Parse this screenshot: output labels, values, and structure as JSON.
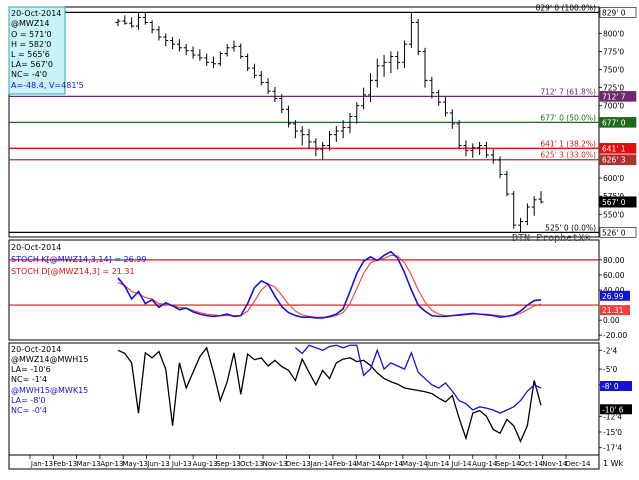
{
  "chart_data": [
    {
      "type": "bar",
      "style": "ohlc",
      "panel": "price",
      "info": {
        "date": "20-Oct-2014",
        "symbol": "@MWZ14",
        "lines": [
          "O = 571'0",
          "H = 582'0",
          "L = 565'6",
          "LA= 567'0",
          "NC= -4'0",
          "A=-48.4, V=481'5"
        ]
      },
      "watermark": "DTN ProphetX®",
      "ylim": [
        520,
        835
      ],
      "y_ticks": [
        {
          "value": 800,
          "label": "800'0"
        },
        {
          "value": 775,
          "label": "775'0"
        },
        {
          "value": 750,
          "label": "750'0"
        },
        {
          "value": 725,
          "label": "725'0"
        },
        {
          "value": 700,
          "label": "700'0"
        },
        {
          "value": 600,
          "label": "600'0"
        },
        {
          "value": 575,
          "label": "575'0"
        },
        {
          "value": 550,
          "label": "550'0"
        }
      ],
      "retracements": [
        {
          "value": 829,
          "label": "829' 0 (100.0%)",
          "color": "#000000",
          "tag": "829' 0",
          "tag_bg": "#ffffff",
          "tag_fg": "#000000"
        },
        {
          "value": 712.875,
          "label": "712' 7 (61.8%)",
          "color": "#6e2a6e",
          "tag": "712' 7",
          "tag_bg": "#6e2a6e",
          "tag_fg": "#ffffff"
        },
        {
          "value": 677,
          "label": "677' 0 (50.0%)",
          "color": "#1e6b1e",
          "tag": "677' 0",
          "tag_bg": "#1e6b1e",
          "tag_fg": "#ffffff"
        },
        {
          "value": 641.125,
          "label": "641' 1 (38.2%)",
          "color": "#e01010",
          "tag": "641' 1",
          "tag_bg": "#e01010",
          "tag_fg": "#ffffff"
        },
        {
          "value": 625.375,
          "label": "625' 3 (33.0%)",
          "color": "#b03030",
          "tag": "626' 3",
          "tag_bg": "#b03030",
          "tag_fg": "#ffffff"
        },
        {
          "value": 525,
          "label": "525' 0 (0.0%)",
          "color": "#000000",
          "tag": "526' 0",
          "tag_bg": "#ffffff",
          "tag_fg": "#000000"
        }
      ],
      "last_tag": {
        "value": 567,
        "label": "567' 0"
      },
      "weekly_ohlc": [
        [
          815,
          820,
          810,
          817
        ],
        [
          817,
          825,
          812,
          814
        ],
        [
          814,
          822,
          808,
          810
        ],
        [
          810,
          828,
          805,
          822
        ],
        [
          822,
          829,
          812,
          815
        ],
        [
          815,
          818,
          800,
          805
        ],
        [
          805,
          810,
          790,
          795
        ],
        [
          795,
          800,
          782,
          790
        ],
        [
          790,
          795,
          778,
          785
        ],
        [
          785,
          792,
          775,
          780
        ],
        [
          780,
          785,
          770,
          776
        ],
        [
          776,
          782,
          765,
          770
        ],
        [
          770,
          778,
          762,
          766
        ],
        [
          766,
          772,
          755,
          760
        ],
        [
          760,
          768,
          752,
          758
        ],
        [
          758,
          775,
          755,
          772
        ],
        [
          772,
          785,
          768,
          780
        ],
        [
          780,
          790,
          775,
          782
        ],
        [
          782,
          786,
          765,
          768
        ],
        [
          768,
          772,
          748,
          752
        ],
        [
          752,
          758,
          738,
          742
        ],
        [
          742,
          748,
          728,
          732
        ],
        [
          732,
          738,
          716,
          720
        ],
        [
          720,
          726,
          705,
          710
        ],
        [
          710,
          716,
          690,
          695
        ],
        [
          695,
          700,
          670,
          675
        ],
        [
          675,
          680,
          655,
          665
        ],
        [
          665,
          672,
          645,
          660
        ],
        [
          660,
          668,
          640,
          650
        ],
        [
          650,
          655,
          630,
          640
        ],
        [
          640,
          650,
          625,
          645
        ],
        [
          645,
          665,
          638,
          660
        ],
        [
          660,
          672,
          650,
          665
        ],
        [
          665,
          680,
          655,
          670
        ],
        [
          670,
          690,
          662,
          685
        ],
        [
          685,
          705,
          675,
          700
        ],
        [
          700,
          725,
          695,
          715
        ],
        [
          715,
          745,
          705,
          735
        ],
        [
          735,
          765,
          725,
          755
        ],
        [
          755,
          770,
          740,
          760
        ],
        [
          760,
          775,
          745,
          768
        ],
        [
          768,
          775,
          750,
          760
        ],
        [
          760,
          790,
          752,
          785
        ],
        [
          785,
          828,
          780,
          815
        ],
        [
          815,
          820,
          770,
          775
        ],
        [
          775,
          780,
          725,
          735
        ],
        [
          735,
          740,
          710,
          718
        ],
        [
          718,
          722,
          700,
          705
        ],
        [
          705,
          712,
          685,
          690
        ],
        [
          690,
          695,
          668,
          675
        ],
        [
          675,
          680,
          640,
          645
        ],
        [
          645,
          652,
          630,
          638
        ],
        [
          638,
          648,
          628,
          642
        ],
        [
          642,
          650,
          632,
          645
        ],
        [
          645,
          650,
          628,
          632
        ],
        [
          632,
          640,
          620,
          625
        ],
        [
          625,
          630,
          600,
          605
        ],
        [
          605,
          610,
          575,
          578
        ],
        [
          578,
          582,
          530,
          535
        ],
        [
          535,
          545,
          525,
          540
        ],
        [
          540,
          565,
          535,
          560
        ],
        [
          560,
          575,
          548,
          570
        ],
        [
          571,
          582,
          565,
          567
        ]
      ],
      "x_labels": [
        "Jan-13",
        "Feb-13",
        "Mar-13",
        "Apr-13",
        "May-13",
        "Jun-13",
        "Jul-13",
        "Aug-13",
        "Sep-13",
        "Oct-13",
        "Nov-13",
        "Dec-13",
        "Jan-14",
        "Feb-14",
        "Mar-14",
        "Apr-14",
        "May-14",
        "Jun-14",
        "Jul-14",
        "Aug-14",
        "Sep-14",
        "Oct-14",
        "Nov-14",
        "Dec-14"
      ],
      "period_label": "1 Wk"
    },
    {
      "type": "line",
      "panel": "stochastic",
      "date": "20-Oct-2014",
      "ylim": [
        -25,
        105
      ],
      "y_ticks": [
        {
          "value": 80,
          "label": "80.00"
        },
        {
          "value": 60,
          "label": "60.00"
        },
        {
          "value": 40,
          "label": "40.00"
        },
        {
          "value": 0,
          "label": "0.00"
        },
        {
          "value": -20,
          "label": "-20.00"
        }
      ],
      "levels": [
        {
          "value": 80,
          "color": "#e01010"
        },
        {
          "value": 20,
          "color": "#e01010"
        }
      ],
      "series": [
        {
          "name": "STOCH K[@MWZ14,3,14] = 26.99",
          "color": "#1414d8",
          "tag": "26.99",
          "values": [
            56,
            45,
            28,
            38,
            22,
            27,
            17,
            23,
            19,
            14,
            16,
            11,
            8,
            6,
            5,
            6,
            8,
            5,
            6,
            22,
            43,
            52,
            48,
            32,
            18,
            10,
            6,
            4,
            4,
            3,
            3,
            5,
            8,
            15,
            38,
            62,
            78,
            84,
            79,
            86,
            91,
            82,
            63,
            40,
            20,
            12,
            6,
            5,
            5,
            6,
            7,
            8,
            9,
            8,
            7,
            6,
            4,
            5,
            7,
            12,
            20,
            26,
            27
          ]
        },
        {
          "name": "STOCH D[@MWZ14,3] = 21.31",
          "color": "#ff3a3a",
          "tag": "21.31",
          "values": [
            50,
            46,
            38,
            35,
            30,
            28,
            22,
            21,
            19,
            17,
            16,
            13,
            10,
            8,
            7,
            6,
            6,
            6,
            6,
            12,
            25,
            40,
            48,
            44,
            33,
            21,
            12,
            7,
            5,
            4,
            4,
            4,
            6,
            10,
            22,
            42,
            62,
            76,
            80,
            82,
            86,
            85,
            76,
            60,
            40,
            24,
            13,
            8,
            6,
            6,
            6,
            7,
            8,
            8,
            8,
            7,
            6,
            5,
            6,
            9,
            14,
            19,
            21.31
          ]
        }
      ]
    },
    {
      "type": "line",
      "panel": "spread",
      "date": "20-Oct-2014",
      "ylim": [
        -18.5,
        -1
      ],
      "y_ticks": [
        {
          "value": -2,
          "label": "-2'4"
        },
        {
          "value": -5,
          "label": "-5'0"
        },
        {
          "value": -7.5,
          "label": "-7'4"
        },
        {
          "value": -12.5,
          "label": "-12'4"
        },
        {
          "value": -15,
          "label": "-15'0"
        },
        {
          "value": -17.5,
          "label": "-17'4"
        }
      ],
      "series": [
        {
          "name": "@MWZ14@MWH15",
          "color": "#000000",
          "info": [
            "LA= -10'6",
            "NC= -1'4"
          ],
          "tag": "-10' 6",
          "values": [
            -2,
            -2.5,
            -4,
            -12,
            -2.4,
            -3.2,
            -2.2,
            -5,
            -14,
            -4,
            -8,
            -5.5,
            -3,
            -1.6,
            -5.5,
            -10,
            -7,
            -2.4,
            -9,
            -2.6,
            -3.5,
            -3.2,
            -4.5,
            -3.6,
            -4.6,
            -5.2,
            -6.8,
            -3.4,
            -5.5,
            -7.5,
            -5.2,
            -6.5,
            -4,
            -3.4,
            -3.2,
            -3.8,
            -3.6,
            -4.4,
            -5.6,
            -6.5,
            -7,
            -7.4,
            -8,
            -8.2,
            -8.4,
            -8.6,
            -8.9,
            -9.6,
            -10.2,
            -9.2,
            -12.8,
            -16,
            -12,
            -11.6,
            -12.5,
            -14.6,
            -15.2,
            -13,
            -14,
            -16.5,
            -14,
            -6.8,
            -10.75
          ]
        },
        {
          "name": "@MWH15@MWK15",
          "color": "#1414d8",
          "info": [
            "LA= -8'0",
            "NC= -0'4"
          ],
          "tag": "-8' 0",
          "values": [
            null,
            null,
            null,
            null,
            null,
            null,
            null,
            null,
            null,
            null,
            null,
            null,
            null,
            null,
            null,
            null,
            null,
            null,
            null,
            null,
            null,
            null,
            null,
            null,
            null,
            null,
            -1.6,
            -2.5,
            -1.2,
            -1.6,
            -2,
            -1.4,
            -1.2,
            -1.6,
            -1.2,
            -1.2,
            -6,
            -5,
            -2,
            -5,
            -4,
            -4.5,
            -5,
            -2.4,
            -5.5,
            -6.5,
            -7.5,
            -8,
            -7.2,
            -8.5,
            -10,
            -10.5,
            -11.5,
            -11,
            -11.2,
            -11.5,
            -12,
            -11.5,
            -11,
            -10,
            -8.5,
            -7.5,
            -8
          ]
        }
      ]
    }
  ]
}
